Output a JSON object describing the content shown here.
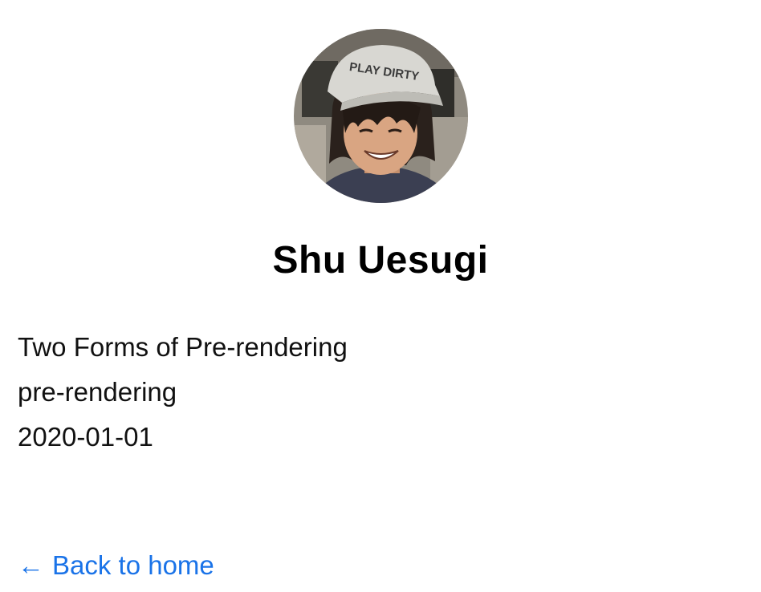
{
  "profile": {
    "name": "Shu Uesugi",
    "avatar_icon": "profile-photo",
    "cap_text": "PLAY DIRTY"
  },
  "post": {
    "title": "Two Forms of Pre-rendering",
    "id": "pre-rendering",
    "date": "2020-01-01"
  },
  "nav": {
    "back_arrow": "←",
    "back_label": "Back to home",
    "link_color": "#1a73e8"
  }
}
